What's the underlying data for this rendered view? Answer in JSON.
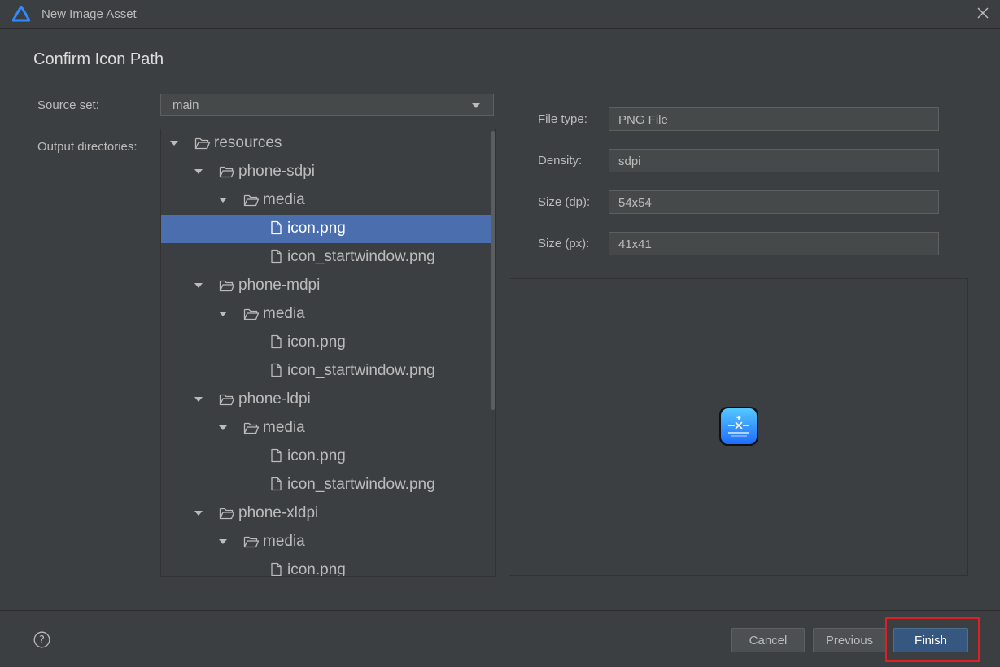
{
  "window": {
    "title": "New Image Asset"
  },
  "page": {
    "heading": "Confirm Icon Path"
  },
  "form": {
    "source_set_label": "Source set:",
    "source_set_value": "main",
    "output_dirs_label": "Output directories:"
  },
  "tree": {
    "selected_index": 3,
    "nodes": [
      {
        "label": "resources",
        "type": "folder",
        "depth": 0,
        "expanded": true
      },
      {
        "label": "phone-sdpi",
        "type": "folder",
        "depth": 1,
        "expanded": true
      },
      {
        "label": "media",
        "type": "folder",
        "depth": 2,
        "expanded": true
      },
      {
        "label": "icon.png",
        "type": "file",
        "depth": 3
      },
      {
        "label": "icon_startwindow.png",
        "type": "file",
        "depth": 3
      },
      {
        "label": "phone-mdpi",
        "type": "folder",
        "depth": 1,
        "expanded": true
      },
      {
        "label": "media",
        "type": "folder",
        "depth": 2,
        "expanded": true
      },
      {
        "label": "icon.png",
        "type": "file",
        "depth": 3
      },
      {
        "label": "icon_startwindow.png",
        "type": "file",
        "depth": 3
      },
      {
        "label": "phone-ldpi",
        "type": "folder",
        "depth": 1,
        "expanded": true
      },
      {
        "label": "media",
        "type": "folder",
        "depth": 2,
        "expanded": true
      },
      {
        "label": "icon.png",
        "type": "file",
        "depth": 3
      },
      {
        "label": "icon_startwindow.png",
        "type": "file",
        "depth": 3
      },
      {
        "label": "phone-xldpi",
        "type": "folder",
        "depth": 1,
        "expanded": true
      },
      {
        "label": "media",
        "type": "folder",
        "depth": 2,
        "expanded": true
      },
      {
        "label": "icon.png",
        "type": "file",
        "depth": 3
      }
    ]
  },
  "details": {
    "file_type_label": "File type:",
    "file_type_value": "PNG File",
    "density_label": "Density:",
    "density_value": "sdpi",
    "size_dp_label": "Size (dp):",
    "size_dp_value": "54x54",
    "size_px_label": "Size (px):",
    "size_px_value": "41x41"
  },
  "buttons": {
    "cancel": "Cancel",
    "previous": "Previous",
    "finish": "Finish"
  },
  "colors": {
    "background": "#3c3f41",
    "selection": "#4b6eaf",
    "primary_button": "#365880",
    "highlight": "#e02020",
    "icon_gradient_top": "#55c8ff",
    "icon_gradient_bottom": "#1e6cff"
  }
}
